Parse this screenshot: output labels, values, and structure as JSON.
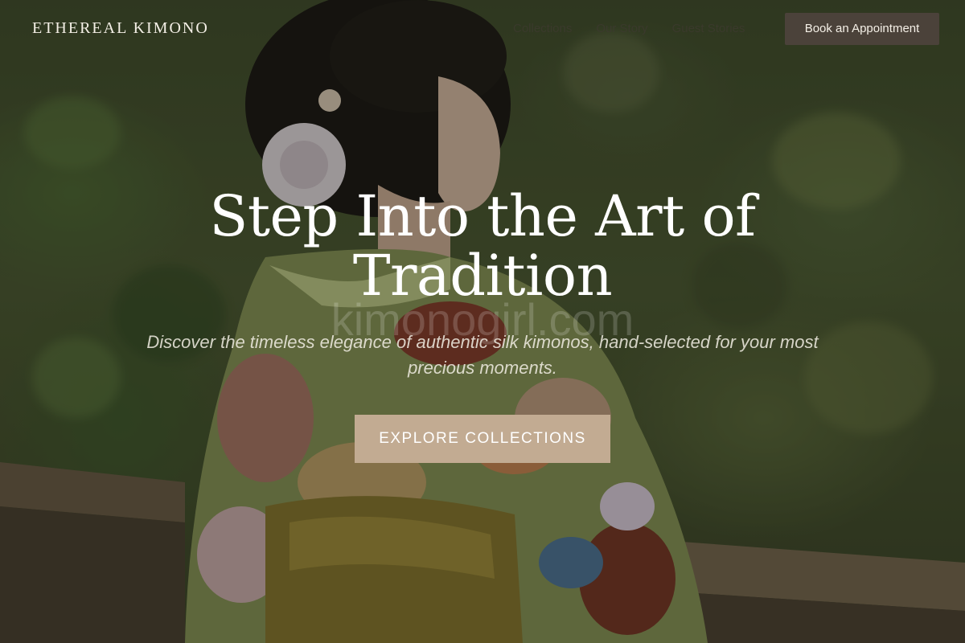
{
  "brand": {
    "name": "ETHEREAL KIMONO"
  },
  "nav": {
    "items": [
      {
        "label": "Collections"
      },
      {
        "label": "Our Story"
      },
      {
        "label": "Guest Stories"
      }
    ],
    "cta_label": "Book an Appointment"
  },
  "hero": {
    "title": "Step Into the Art of Tradition",
    "subtitle": "Discover the timeless elegance of authentic silk kimonos, hand-selected for your most precious moments.",
    "cta_label": "EXPLORE COLLECTIONS",
    "watermark": "kimonogirl.com"
  },
  "colors": {
    "cta_background": "#c2ab92",
    "book_button_background": "#4b423a",
    "text": "#ffffff"
  }
}
